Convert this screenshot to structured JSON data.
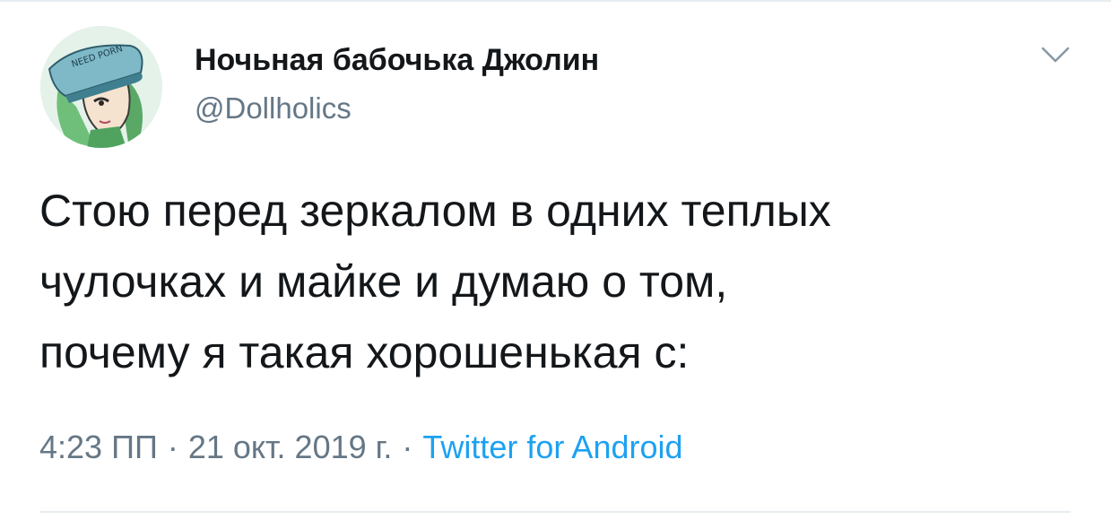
{
  "author": {
    "display_name": "Ночьная бабочька Джолин",
    "handle": "@Dollholics",
    "avatar_cap_text": "NEED PORN"
  },
  "tweet": {
    "text": "Стою перед зеркалом в одних теплых\nчулочках и майке и думаю о том,\nпочему я такая хорошенькая с:",
    "time": "4:23 ПП",
    "separator": "·",
    "date": "21 окт. 2019 г.",
    "source": "Twitter for Android"
  },
  "icons": {
    "menu": "chevron-down-icon"
  },
  "colors": {
    "name": "#14171a",
    "secondary": "#657786",
    "link": "#1da1f2",
    "divider": "#e6ecf0"
  }
}
